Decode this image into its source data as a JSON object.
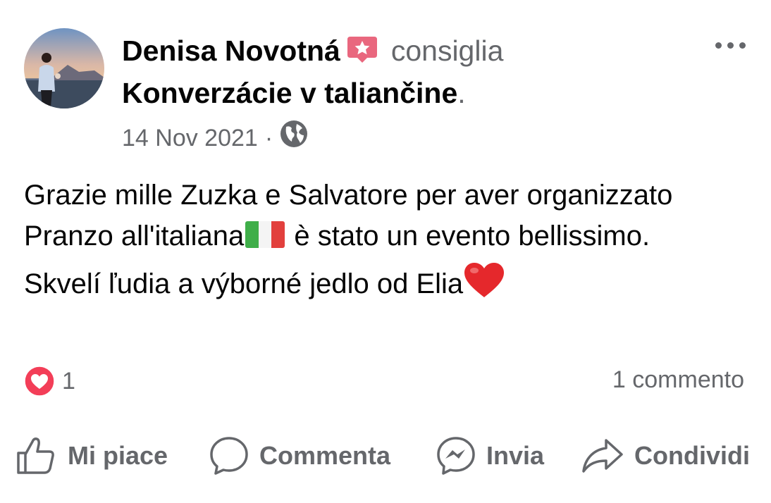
{
  "post": {
    "author": "Denisa Novotná",
    "action_verb": "consiglia",
    "page_name": "Konverzácie v taliančine",
    "page_suffix": ".",
    "date": "14 Nov 2021",
    "meta_separator": "·",
    "audience_icon": "globe-icon",
    "text_parts": {
      "part1": "Grazie mille Zuzka e Salvatore per aver organizzato Pranzo all'italiana",
      "emoji1": "italian-flag",
      "part2": " è stato un evento bellissimo. Skvelí ľudia a výborné jedlo od Elia",
      "emoji2": "red-heart"
    }
  },
  "reactions": {
    "icon": "heart-reaction-icon",
    "count": "1"
  },
  "comments": {
    "count_label": "1 commento"
  },
  "actions": {
    "like": "Mi piace",
    "comment": "Commenta",
    "send": "Invia",
    "share": "Condividi"
  },
  "colors": {
    "text_primary": "#050505",
    "text_secondary": "#65676b",
    "badge_pink": "#e9677e",
    "reaction_red": "#f33e58"
  }
}
